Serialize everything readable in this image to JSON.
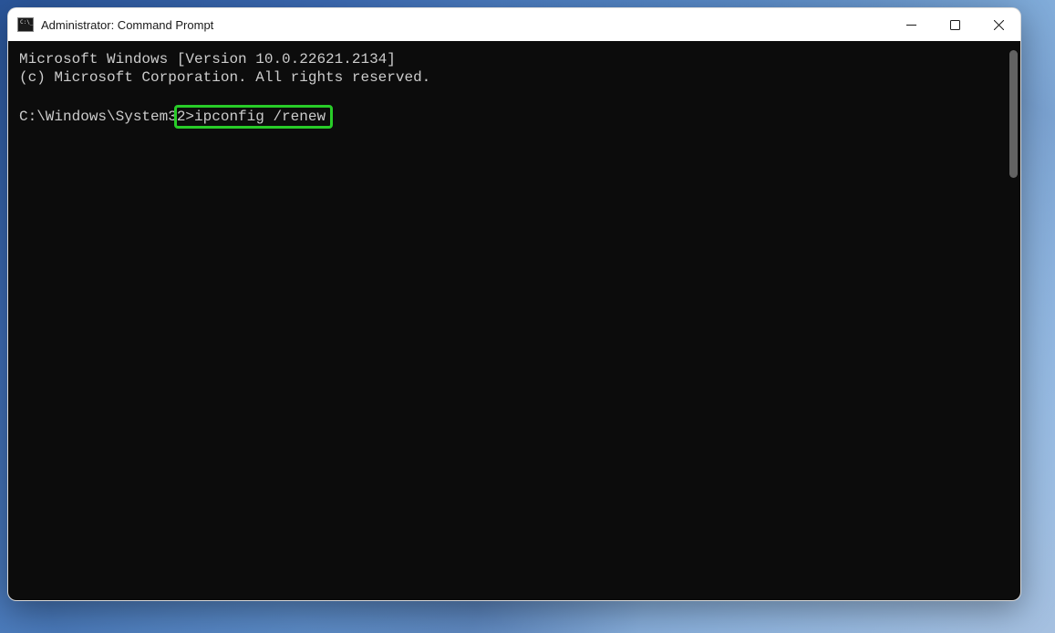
{
  "window": {
    "title": "Administrator: Command Prompt"
  },
  "terminal": {
    "line1": "Microsoft Windows [Version 10.0.22621.2134]",
    "line2": "(c) Microsoft Corporation. All rights reserved.",
    "prompt_prefix": "C:\\Windows\\System3",
    "prompt_highlight": "2>ipconfig /renew "
  },
  "colors": {
    "highlight_border": "#28cc28",
    "terminal_bg": "#0c0c0c",
    "terminal_fg": "#cccccc"
  }
}
